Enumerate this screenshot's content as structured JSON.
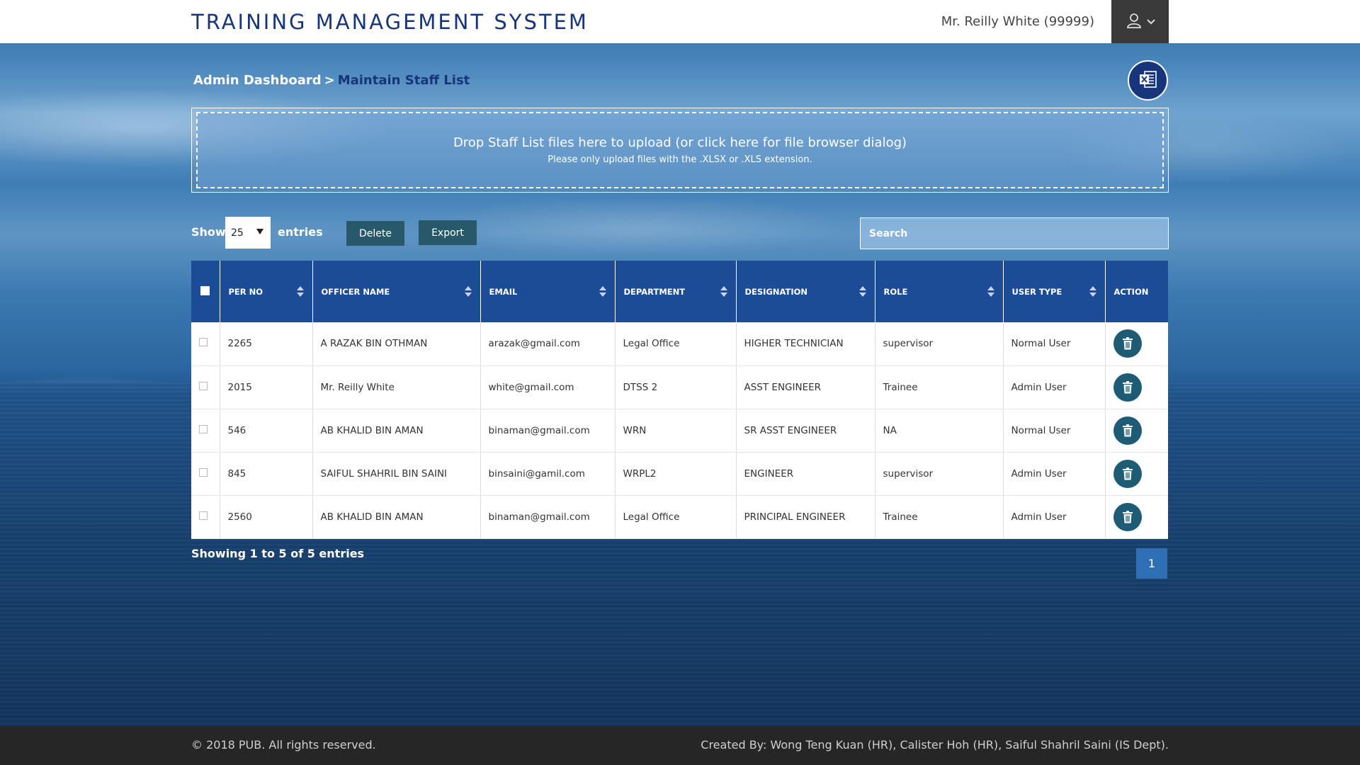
{
  "header": {
    "app_title": "TRAINING MANAGEMENT SYSTEM",
    "user_name": "Mr. Reilly White (99999)"
  },
  "breadcrumb": {
    "root": "Admin Dashboard",
    "separator": ">",
    "current": "Maintain Staff List"
  },
  "upload": {
    "main_text": "Drop Staff List files here to upload (or click here for file browser dialog)",
    "sub_text": "Please only upload files with the .XLSX or .XLS extension."
  },
  "controls": {
    "show_label": "Show",
    "page_length": "25",
    "entries_label": "entries",
    "delete_label": "Delete",
    "export_label": "Export",
    "search_placeholder": "Search"
  },
  "table": {
    "columns": [
      "PER NO",
      "OFFICER NAME",
      "EMAIL",
      "DEPARTMENT",
      "DESIGNATION",
      "ROLE",
      "USER TYPE",
      "ACTION"
    ],
    "rows": [
      {
        "per_no": "2265",
        "name": "A RAZAK BIN OTHMAN",
        "email": "arazak@gmail.com",
        "department": "Legal Office",
        "designation": "HIGHER TECHNICIAN",
        "role": "supervisor",
        "user_type": "Normal User"
      },
      {
        "per_no": "2015",
        "name": "Mr. Reilly White",
        "email": "white@gmail.com",
        "department": "DTSS 2",
        "designation": "ASST ENGINEER",
        "role": "Trainee",
        "user_type": "Admin User"
      },
      {
        "per_no": "546",
        "name": "AB KHALID BIN AMAN",
        "email": "binaman@gmail.com",
        "department": "WRN",
        "designation": "SR ASST ENGINEER",
        "role": "NA",
        "user_type": "Normal User"
      },
      {
        "per_no": "845",
        "name": "SAIFUL SHAHRIL BIN SAINI",
        "email": "binsaini@gamil.com",
        "department": "WRPL2",
        "designation": "ENGINEER",
        "role": "supervisor",
        "user_type": "Admin User"
      },
      {
        "per_no": "2560",
        "name": "AB KHALID BIN AMAN",
        "email": "binaman@gmail.com",
        "department": "Legal Office",
        "designation": "PRINCIPAL ENGINEER",
        "role": "Trainee",
        "user_type": "Admin User"
      }
    ]
  },
  "pagination": {
    "info": "Showing 1 to 5 of 5 entries",
    "current_page": "1"
  },
  "footer": {
    "copyright": "© 2018 PUB. All rights reserved.",
    "credits": "Created By: Wong Teng Kuan (HR), Calister Hoh (HR), Saiful Shahril Saini (IS Dept)."
  },
  "colors": {
    "brand_navy": "#16357a",
    "table_header": "#1d4c97",
    "button_teal": "#27596a",
    "action_circle": "#1e5b75",
    "footer_bg": "#262626"
  },
  "icons": {
    "user_menu": "user-icon",
    "dropdown": "chevron-down-icon",
    "excel": "excel-icon",
    "delete_row": "trash-icon"
  }
}
